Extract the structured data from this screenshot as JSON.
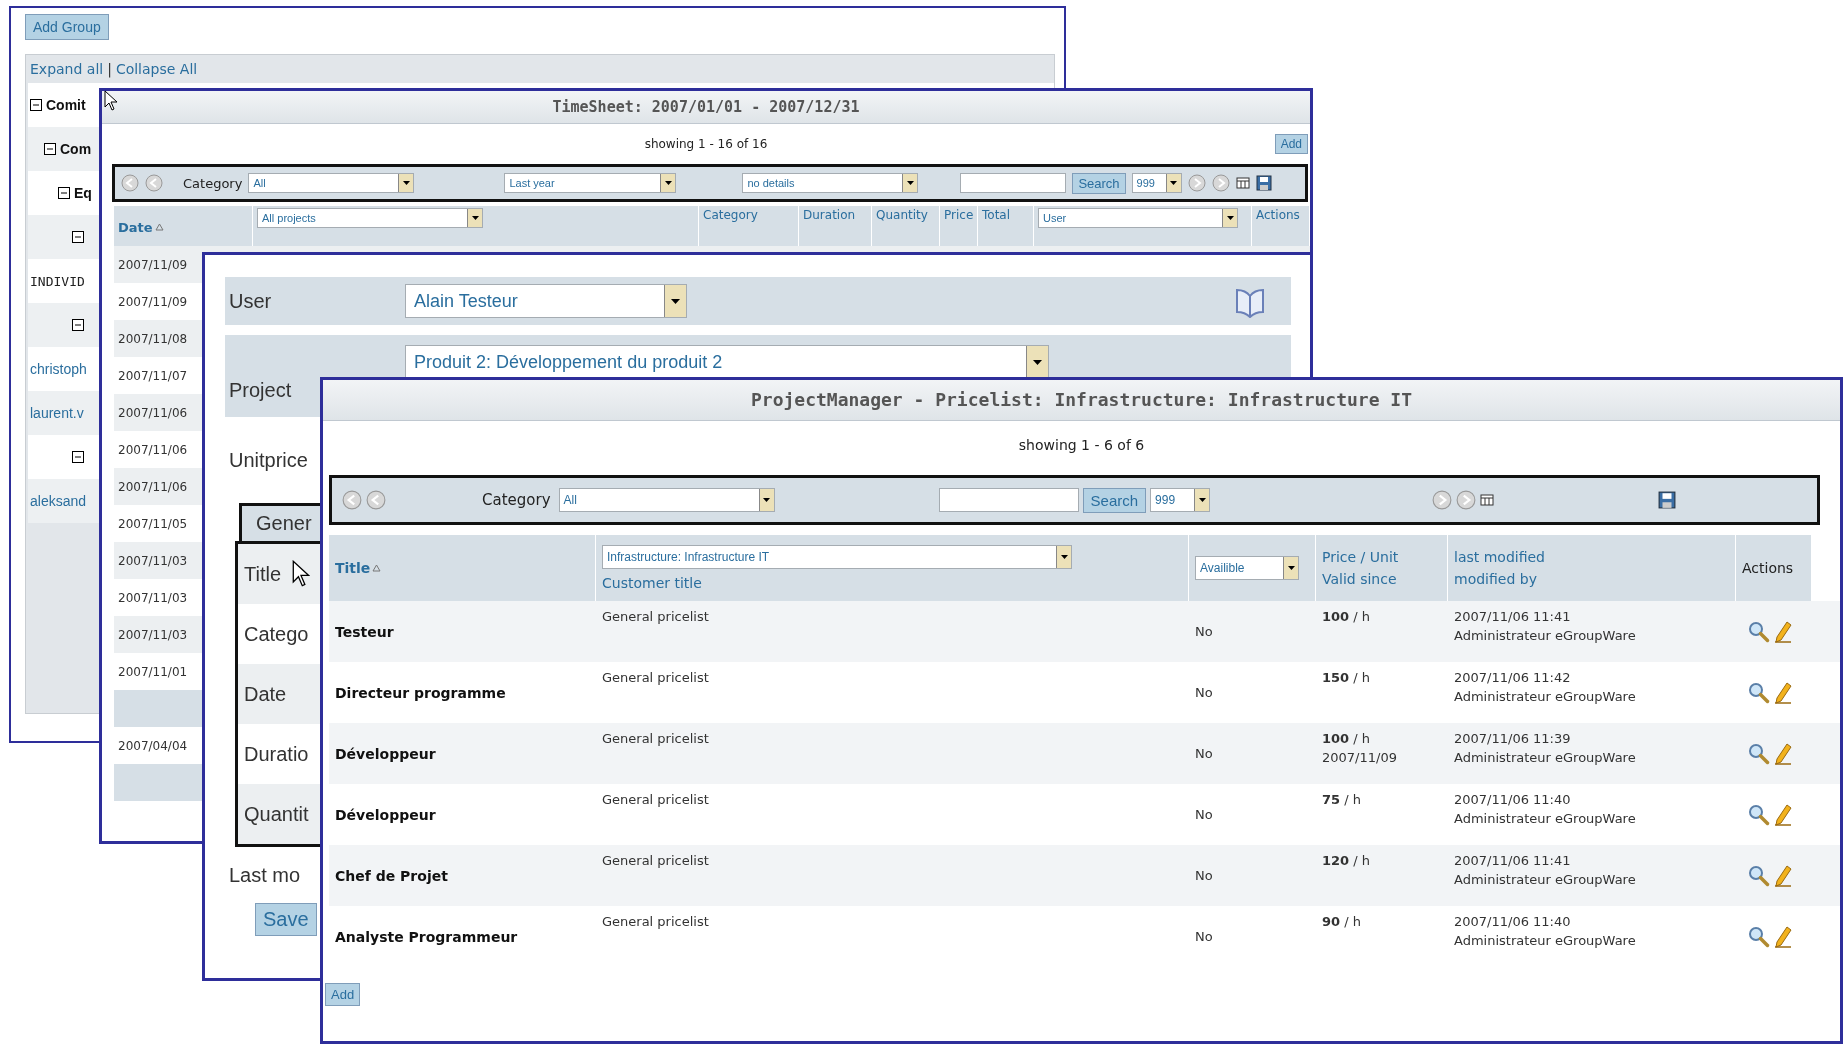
{
  "groups_window": {
    "add_button": "Add Group",
    "expand_all": "Expand all",
    "separator": "|",
    "collapse_all": "Collapse All",
    "tree": [
      {
        "label": "Comit",
        "expanded": true,
        "children": [
          {
            "label": "Com",
            "expanded": true,
            "children": [
              {
                "label": "Eq",
                "expanded": true,
                "children": [
                  {
                    "expanded": true,
                    "members": [
                      {
                        "kind": "text",
                        "text": "INDIVID"
                      }
                    ]
                  },
                  {
                    "expanded": true,
                    "members": [
                      {
                        "kind": "link",
                        "text": "christoph"
                      },
                      {
                        "kind": "link",
                        "text": "laurent.v"
                      }
                    ]
                  },
                  {
                    "expanded": true,
                    "members": [
                      {
                        "kind": "link",
                        "text": "aleksand"
                      }
                    ]
                  }
                ]
              }
            ]
          }
        ]
      }
    ]
  },
  "timesheet_window": {
    "title": "TimeSheet: 2007/01/01 - 2007/12/31",
    "showing": "showing 1 - 16 of 16",
    "add_button": "Add",
    "toolbar": {
      "category_label": "Category",
      "category": "All",
      "period": "Last year",
      "details": "no details",
      "search_button": "Search",
      "page_size": "999"
    },
    "columns": {
      "date": "Date",
      "project": "All projects",
      "category": "Category",
      "duration": "Duration",
      "quantity": "Quantity",
      "price": "Price",
      "total": "Total",
      "user": "User",
      "actions": "Actions"
    },
    "rows": [
      {
        "kind": "entry",
        "date": "2007/11/09"
      },
      {
        "kind": "entry",
        "date": "2007/11/09"
      },
      {
        "kind": "entry",
        "date": "2007/11/08"
      },
      {
        "kind": "entry",
        "date": "2007/11/07"
      },
      {
        "kind": "entry",
        "date": "2007/11/06"
      },
      {
        "kind": "entry",
        "date": "2007/11/06"
      },
      {
        "kind": "entry",
        "date": "2007/11/06"
      },
      {
        "kind": "entry",
        "date": "2007/11/05"
      },
      {
        "kind": "entry",
        "date": "2007/11/03"
      },
      {
        "kind": "entry",
        "date": "2007/11/03"
      },
      {
        "kind": "entry",
        "date": "2007/11/03"
      },
      {
        "kind": "entry",
        "date": "2007/11/01"
      },
      {
        "kind": "sum"
      },
      {
        "kind": "entry",
        "date": "2007/04/04"
      },
      {
        "kind": "sum"
      }
    ]
  },
  "edit_window": {
    "user_label": "User",
    "user": "Alain Testeur",
    "project_label": "Project",
    "project": "Produit 2: Développement du produit 2",
    "unitprice_label": "Unitprice",
    "tab": "Gener",
    "fields": [
      "Title",
      "Catego",
      "Date",
      "Duratio",
      "Quantit"
    ],
    "last_modified_label": "Last mo",
    "save_button": "Save"
  },
  "pricelist_window": {
    "title": "ProjectManager - Pricelist: Infrastructure: Infrastructure IT",
    "showing": "showing 1 - 6 of 6",
    "toolbar": {
      "category_label": "Category",
      "category": "All",
      "search_button": "Search",
      "page_size": "999"
    },
    "columns": {
      "title": "Title",
      "pricelist": "Infrastructure: Infrastructure IT",
      "customer_title": "Customer title",
      "availability": "Availible",
      "price_unit": "Price / Unit",
      "valid_since": "Valid since",
      "last_modified": "last modified",
      "modified_by": "modified by",
      "actions": "Actions"
    },
    "rows": [
      {
        "title": "Testeur",
        "pricelist": "General pricelist",
        "available": "No",
        "price": "**100** / h",
        "modified": "2007/11/06 11:41",
        "modified_by": "Administrateur eGroupWare"
      },
      {
        "title": "Directeur programme",
        "pricelist": "General pricelist",
        "available": "No",
        "price": "**150** / h",
        "modified": "2007/11/06 11:42",
        "modified_by": "Administrateur eGroupWare"
      },
      {
        "title": "Développeur",
        "pricelist": "General pricelist",
        "available": "No",
        "price": "**100** / h",
        "valid_since": "2007/11/09",
        "modified": "2007/11/06 11:39",
        "modified_by": "Administrateur eGroupWare"
      },
      {
        "title": "Développeur",
        "pricelist": "General pricelist",
        "available": "No",
        "price": "**75** / h",
        "modified": "2007/11/06 11:40",
        "modified_by": "Administrateur eGroupWare"
      },
      {
        "title": "Chef de Projet",
        "pricelist": "General pricelist",
        "available": "No",
        "price": "**120** / h",
        "modified": "2007/11/06 11:41",
        "modified_by": "Administrateur eGroupWare"
      },
      {
        "title": "Analyste Programmeur",
        "pricelist": "General pricelist",
        "available": "No",
        "price": "**90** / h",
        "modified": "2007/11/06 11:40",
        "modified_by": "Administrateur eGroupWare"
      }
    ],
    "add_button": "Add"
  }
}
